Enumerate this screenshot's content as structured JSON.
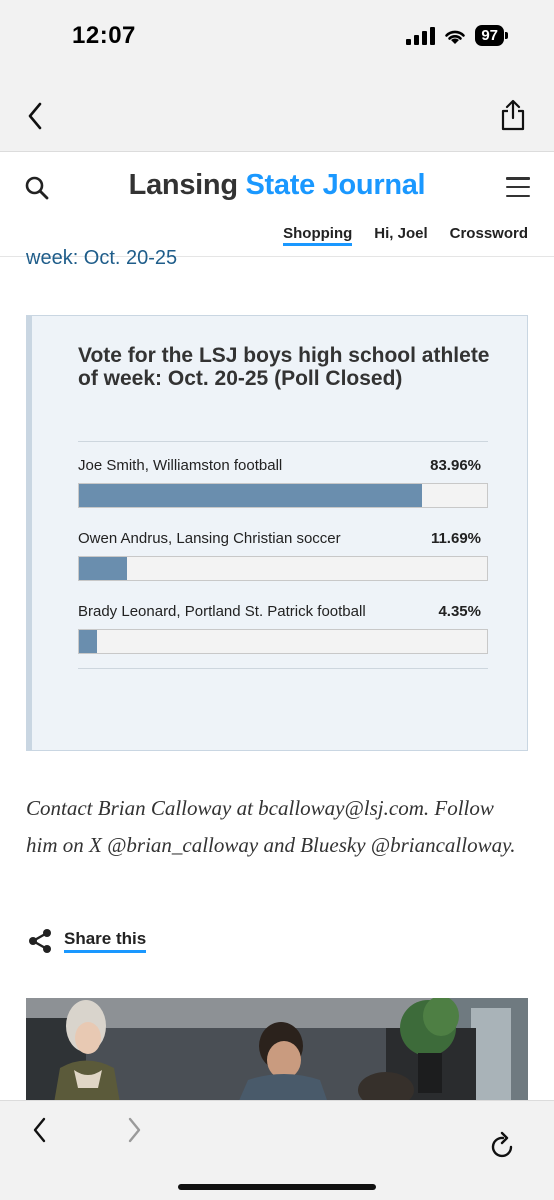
{
  "status_bar": {
    "time": "12:07",
    "battery": "97"
  },
  "header": {
    "logo_part1": "Lansing",
    "logo_part2": "State Journal",
    "nav": {
      "shopping": "Shopping",
      "greeting": "Hi, Joel",
      "crossword": "Crossword"
    }
  },
  "article": {
    "cut_heading": "week: Oct. 20-25",
    "poll": {
      "title": "Vote for the LSJ boys high school athlete of week: Oct. 20-25 (Poll Closed)",
      "options": [
        {
          "label": "Joe Smith, Williamston football",
          "percent_text": "83.96%",
          "value": 83.96
        },
        {
          "label": "Owen Andrus, Lansing Christian soccer",
          "percent_text": "11.69%",
          "value": 11.69
        },
        {
          "label": "Brady Leonard, Portland St. Patrick football",
          "percent_text": "4.35%",
          "value": 4.35
        }
      ]
    },
    "contact_text": "Contact Brian Calloway at bcalloway@lsj.com. Follow him on X @brian_calloway and Bluesky @briancalloway.",
    "share_label": "Share this"
  },
  "icons": {
    "browser_back": "chevron-left-icon",
    "browser_share": "share-upload-icon",
    "search": "search-icon",
    "menu": "hamburger-menu-icon",
    "share": "share-nodes-icon",
    "nav_back": "chevron-left-icon",
    "nav_forward": "chevron-right-icon",
    "reload": "reload-icon"
  },
  "colors": {
    "brand_blue": "#1a98ff",
    "poll_bar": "#6a8eae",
    "poll_bg": "#eef3f8"
  }
}
